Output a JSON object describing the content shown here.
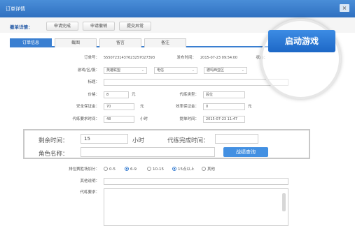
{
  "window": {
    "title": "订单详情",
    "close": "×"
  },
  "toolbar": {
    "label": "撤单详情：",
    "buttons": [
      "申请完成",
      "申请撤销",
      "提交异常"
    ]
  },
  "launch_button": "启动游戏",
  "tabs": [
    {
      "label": "订单信息",
      "active": true
    },
    {
      "label": "截图",
      "active": false
    },
    {
      "label": "留言",
      "active": false
    },
    {
      "label": "备注",
      "active": false
    }
  ],
  "order": {
    "order_no_label": "订单号：",
    "order_no": "55507231437623257027393",
    "publish_time_label": "发布时间：",
    "publish_time": "2015-07-23 09:54:00",
    "status_label": "状态："
  },
  "game": {
    "label": "游戏/区/服：",
    "game": "英雄联盟",
    "area": "电信",
    "server": "德玛西亚区"
  },
  "title": {
    "label": "标题：",
    "value": ""
  },
  "price": {
    "label": "价格：",
    "value": "8",
    "unit": "元"
  },
  "type": {
    "label": "代练类型：",
    "value": "段位"
  },
  "deposit": {
    "label": "安全保证金：",
    "value": "70",
    "unit": "元"
  },
  "efficiency_deposit": {
    "label": "效率保证金：",
    "value": "0",
    "unit": "元"
  },
  "required_time": {
    "label": "代练要求时间：",
    "value": "48",
    "unit": "小时"
  },
  "submit_time": {
    "label": "提单时间：",
    "value": "2015-07-23 11:47"
  },
  "highlight": {
    "remaining_label": "剩余时间：",
    "remaining_value": "15",
    "remaining_unit": "小时",
    "finish_label": "代练完成时间：",
    "finish_value": "",
    "role_label": "角色名称：",
    "role_value": "",
    "query_button": "战绩查询"
  },
  "bonus": {
    "label": "排位赛胜场加分：",
    "options": [
      {
        "label": "0-5",
        "checked": false
      },
      {
        "label": "6-9",
        "checked": true
      },
      {
        "label": "10-15",
        "checked": false
      },
      {
        "label": "15点以上",
        "checked": true
      },
      {
        "label": "其他",
        "checked": false
      }
    ]
  },
  "other_desc": {
    "label": "其他说明：",
    "value": ""
  },
  "requirement": {
    "label": "代练要求：",
    "value": ""
  },
  "colors": {
    "accent": "#3a7fd1",
    "title_bar": "#2f70c0"
  }
}
